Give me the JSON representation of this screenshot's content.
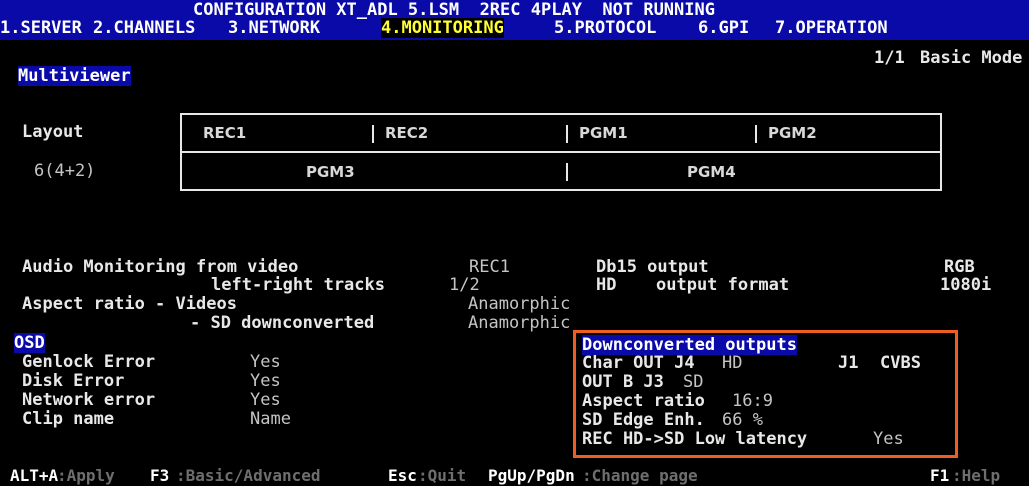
{
  "header": {
    "title": "CONFIGURATION XT_ADL 5.LSM  2REC 4PLAY  NOT RUNNING",
    "tabs": [
      {
        "label": "1.SERVER"
      },
      {
        "label": "2.CHANNELS"
      },
      {
        "label": "3.NETWORK"
      },
      {
        "label": "4.MONITORING"
      },
      {
        "label": "5.PROTOCOL"
      },
      {
        "label": "6.GPI"
      },
      {
        "label": "7.OPERATION"
      }
    ],
    "page_indicator": "1/1",
    "mode": "Basic Mode"
  },
  "multiviewer": {
    "section_title": "Multiviewer",
    "layout_label": "Layout",
    "layout_value": "6(4+2)",
    "top_cells": [
      "REC1",
      "REC2",
      "PGM1",
      "PGM2"
    ],
    "bottom_cells": [
      "PGM3",
      "PGM4"
    ]
  },
  "audio": {
    "label": "Audio Monitoring from video",
    "value": "REC1",
    "tracks_label": "left-right tracks",
    "tracks_value": "1/2"
  },
  "db15": {
    "label": "Db15 output",
    "value": "RGB"
  },
  "hd_format": {
    "prefix": "HD",
    "label": "output format",
    "value": "1080i"
  },
  "aspect": {
    "label": "Aspect ratio - Videos",
    "value": "Anamorphic",
    "sd_label": "- SD downconverted",
    "sd_value": "Anamorphic"
  },
  "osd": {
    "title": "OSD",
    "items": [
      {
        "label": "Genlock Error",
        "value": "Yes"
      },
      {
        "label": "Disk Error",
        "value": "Yes"
      },
      {
        "label": "Network error",
        "value": "Yes"
      },
      {
        "label": "Clip name",
        "value": "Name"
      }
    ]
  },
  "downconverted": {
    "title": "Downconverted outputs",
    "char_out_label": "Char OUT J4",
    "char_out_value": "HD",
    "j1_label": "J1",
    "j1_value": "CVBS",
    "out_b_label": "OUT B J3",
    "out_b_value": "SD",
    "aspect_label": "Aspect ratio",
    "aspect_value": "16:9",
    "edge_label": "SD Edge Enh.",
    "edge_value": "66 %",
    "latency_label": "REC HD->SD Low latency",
    "latency_value": "Yes"
  },
  "footer": {
    "items": [
      {
        "key": "ALT+A",
        "desc": ":Apply"
      },
      {
        "key": "F3",
        "desc": ":Basic/Advanced"
      },
      {
        "key": "Esc",
        "desc": ":Quit"
      },
      {
        "key": "PgUp/PgDn",
        "desc": ":Change page"
      },
      {
        "key": "F1",
        "desc": ":Help"
      }
    ]
  },
  "colors": {
    "title_bar": "#0a0aa8",
    "active_tab": "#ffff33",
    "highlight_box": "#ee5d24",
    "text": "#e8e8e8"
  }
}
